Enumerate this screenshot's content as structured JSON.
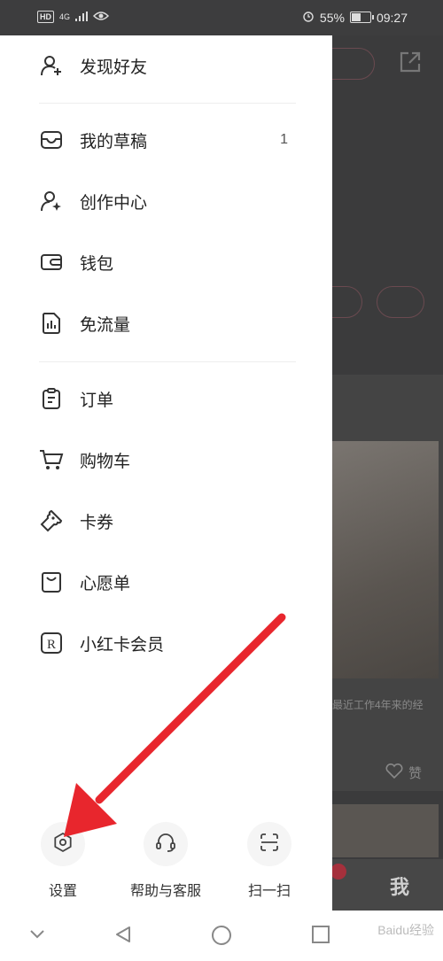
{
  "status_bar": {
    "hd": "HD",
    "network": "4G",
    "battery": "55%",
    "battery_level": 0.55,
    "time": "09:27"
  },
  "drawer": {
    "items": [
      {
        "label": "发现好友",
        "icon": "add-friend-icon"
      },
      {
        "label": "我的草稿",
        "icon": "drafts-icon",
        "count": "1"
      },
      {
        "label": "创作中心",
        "icon": "creator-center-icon"
      },
      {
        "label": "钱包",
        "icon": "wallet-icon"
      },
      {
        "label": "免流量",
        "icon": "free-data-icon"
      },
      {
        "label": "订单",
        "icon": "orders-icon"
      },
      {
        "label": "购物车",
        "icon": "cart-icon"
      },
      {
        "label": "卡券",
        "icon": "coupon-icon"
      },
      {
        "label": "心愿单",
        "icon": "wishlist-icon"
      },
      {
        "label": "小红卡会员",
        "icon": "membership-icon"
      }
    ],
    "bottom": {
      "settings": "设置",
      "help": "帮助与客服",
      "scan": "扫一扫"
    }
  },
  "background_app": {
    "caption": "最近工作4年来的经",
    "me_tab": "我",
    "like_count": "赞"
  },
  "watermark": "Baidu经验",
  "colors": {
    "annotation_arrow": "#e8262d",
    "drawer_bg": "#ffffff",
    "overlay": "#3b3b3c"
  }
}
